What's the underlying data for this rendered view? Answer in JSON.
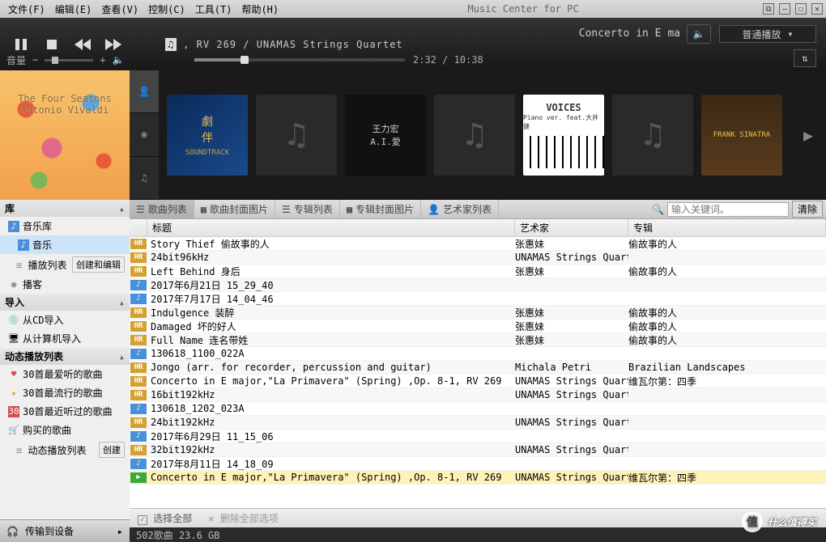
{
  "app": {
    "title": "Music Center for PC"
  },
  "menu": [
    "文件(F)",
    "编辑(E)",
    "查看(V)",
    "控制(C)",
    "工具(T)",
    "帮助(H)"
  ],
  "player": {
    "trackline": ", RV 269 / UNAMAS Strings Quartet",
    "scroll_right": "Concerto in E ma",
    "mode": "普通播放",
    "time": "2:32 / 10:38"
  },
  "volume": {
    "label": "音量"
  },
  "bigcover": {
    "line1": "The Four Seasons",
    "line2": "Antonio Vivaldi"
  },
  "thumbs": {
    "t1_sub": "SOUNDTRACK",
    "t4_top": "VOICES",
    "t4_sub": "Piano ver.\nfeat.大井健",
    "t6_top": "FRANK SINATRA"
  },
  "sidebar": {
    "sec_ku": "库",
    "musiclib": "音乐库",
    "music": "音乐",
    "playlist": "播放列表",
    "create_edit": "创建和编辑",
    "podcast": "播客",
    "sec_import": "导入",
    "from_cd": "从CD导入",
    "from_pc": "从计算机导入",
    "sec_dynpl": "动态播放列表",
    "p1": "30首最爱听的歌曲",
    "p2": "30首最流行的歌曲",
    "p3": "30首最近听过的歌曲",
    "p4": "购买的歌曲",
    "p5": "动态播放列表",
    "create": "创建",
    "transfer": "传输到设备"
  },
  "toolbar": {
    "songlist": "歌曲列表",
    "songcover": "歌曲封面图片",
    "albumlist": "专辑列表",
    "albumcover": "专辑封面图片",
    "artistlist": "艺术家列表",
    "search_ph": "输入关键词。",
    "clear": "清除"
  },
  "columns": {
    "title": "标题",
    "artist": "艺术家",
    "album": "专辑"
  },
  "rows": [
    {
      "b": "hr",
      "t": "Story Thief 偷故事的人",
      "a": "张惠妹",
      "al": "偷故事的人"
    },
    {
      "b": "hr",
      "t": "24bit96kHz",
      "a": "UNAMAS Strings Quartet",
      "al": ""
    },
    {
      "b": "hr",
      "t": "Left Behind 身后",
      "a": "张惠妹",
      "al": "偷故事的人"
    },
    {
      "b": "nt",
      "t": "2017年6月21日 15_29_40",
      "a": "",
      "al": ""
    },
    {
      "b": "nt",
      "t": "2017年7月17日 14_04_46",
      "a": "",
      "al": ""
    },
    {
      "b": "hr",
      "t": "Indulgence 装醉",
      "a": "张惠妹",
      "al": "偷故事的人"
    },
    {
      "b": "hr",
      "t": "Damaged 坏的好人",
      "a": "张惠妹",
      "al": "偷故事的人"
    },
    {
      "b": "hr",
      "t": "Full Name 连名带姓",
      "a": "张惠妹",
      "al": "偷故事的人"
    },
    {
      "b": "nt",
      "t": "130618_1100_022A",
      "a": "",
      "al": ""
    },
    {
      "b": "hr",
      "t": "Jongo (arr. for recorder, percussion and guitar)",
      "a": "Michala Petri",
      "al": "Brazilian Landscapes"
    },
    {
      "b": "hr",
      "t": "Concerto in E major,\"La Primavera\" (Spring) ,Op. 8-1, RV 269",
      "a": "UNAMAS Strings Quartet",
      "al": "维瓦尔第：四季"
    },
    {
      "b": "hr",
      "t": "16bit192kHz",
      "a": "UNAMAS Strings Quartet",
      "al": ""
    },
    {
      "b": "nt",
      "t": "130618_1202_023A",
      "a": "",
      "al": ""
    },
    {
      "b": "hr",
      "t": "24bit192kHz",
      "a": "UNAMAS Strings Quartet",
      "al": ""
    },
    {
      "b": "nt",
      "t": "2017年6月29日 11_15_06",
      "a": "",
      "al": ""
    },
    {
      "b": "hr",
      "t": "32bit192kHz",
      "a": "UNAMAS Strings Quartet",
      "al": ""
    },
    {
      "b": "nt",
      "t": "2017年8月11日 14_18_09",
      "a": "",
      "al": ""
    },
    {
      "b": "pl",
      "t": "Concerto in E major,\"La Primavera\" (Spring) ,Op. 8-1, RV 269",
      "a": "UNAMAS Strings Quartet",
      "al": "维瓦尔第：四季",
      "playing": true
    }
  ],
  "selbar": {
    "selectall": "选择全部",
    "clearsel": "删除全部选项"
  },
  "status": {
    "text": "502歌曲 23.6 GB"
  },
  "watermark": {
    "text": "什么值得买",
    "badge": "值"
  }
}
